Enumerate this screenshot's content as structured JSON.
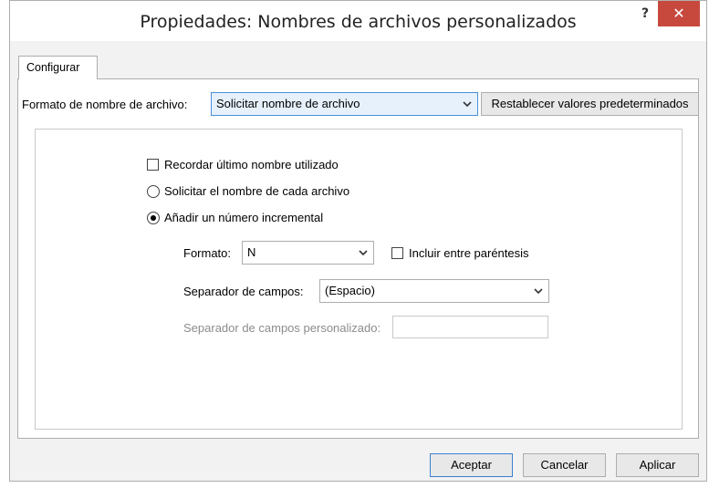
{
  "window": {
    "title": "Propiedades: Nombres de archivos personalizados",
    "help_label": "?",
    "close_label": "✕"
  },
  "tabs": [
    {
      "label": "Configurar",
      "selected": true
    }
  ],
  "format": {
    "label": "Formato de nombre de archivo:",
    "selected_value": "Solicitar nombre de archivo",
    "reset_button": "Restablecer valores predeterminados"
  },
  "options": {
    "remember_last": {
      "label": "Recordar último nombre utilizado",
      "checked": false
    },
    "ask_each": {
      "label": "Solicitar el nombre de cada archivo",
      "selected": false
    },
    "add_increment": {
      "label": "Añadir un número incremental",
      "selected": true
    }
  },
  "increment": {
    "format_label": "Formato:",
    "format_value": "N",
    "include_parentheses_label": "Incluir entre paréntesis",
    "include_parentheses_checked": false,
    "separator_label": "Separador de campos:",
    "separator_value": "(Espacio)",
    "custom_separator_label": "Separador de campos personalizado:",
    "custom_separator_value": ""
  },
  "footer": {
    "accept": "Aceptar",
    "cancel": "Cancelar",
    "apply": "Aplicar"
  },
  "colors": {
    "close_button": "#c7493d",
    "focus_border": "#4a90d9"
  }
}
